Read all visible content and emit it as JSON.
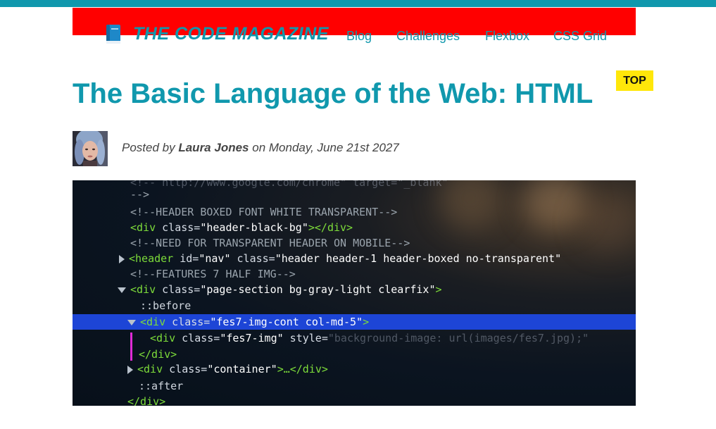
{
  "colors": {
    "accent": "#1098ad",
    "header_bg": "#ff0000",
    "badge_bg": "#ffe70a",
    "highlight": "#1d45d6",
    "code_tag": "#7ddc3a"
  },
  "header": {
    "brand_icon": "book-icon",
    "brand_name": "THE CODE MAGAZINE",
    "nav": [
      "Blog",
      "Challenges",
      "Flexbox",
      "CSS Grid"
    ]
  },
  "top_button": "TOP",
  "article": {
    "title": "The Basic Language of the Web: HTML",
    "byline": {
      "prefix": "Posted by",
      "author": "Laura Jones",
      "middle": "on",
      "date": "Monday, June 21st 2027"
    },
    "avatar_icon": "author-avatar",
    "hero_code": [
      {
        "text": "<!--  http://www.google.com/chrome\" target=\"_blank\"",
        "type": "comment"
      },
      {
        "text": "-->",
        "type": "comment"
      },
      {
        "text": "<!--HEADER BOXED FONT WHITE TRANSPARENT-->",
        "type": "comment"
      },
      {
        "tag": "<div",
        "attr": " class=",
        "val": "\"header-black-bg\"",
        "close": "></div>"
      },
      {
        "text": "<!--NEED FOR TRANSPARENT HEADER ON MOBILE-->",
        "type": "comment"
      },
      {
        "tag": "<header",
        "attr": " id=",
        "val": "\"nav\"",
        "attr2": " class=",
        "val2": "\"header header-1 header-boxed no-transparent\""
      },
      {
        "text": "<!--FEATURES 7 HALF IMG-->",
        "type": "comment"
      },
      {
        "tag": "<div",
        "attr": " class=",
        "val": "\"page-section bg-gray-light clearfix\"",
        "close": ">"
      },
      {
        "text": "::before",
        "type": "pseudo"
      },
      {
        "tag": "<div",
        "attr": " class=",
        "val": "\"fes7-img-cont col-md-5\"",
        "close": ">"
      },
      {
        "tag": "<div",
        "attr": " class=",
        "val": "\"fes7-img\"",
        "attr2": " style=",
        "val2": "\"background-image: url(images/fes7.jpg);\""
      },
      {
        "tag": "</div>",
        "type": "closetag"
      },
      {
        "tag": "<div",
        "attr": " class=",
        "val": "\"container\"",
        "close": ">…</div>"
      },
      {
        "text": "::after",
        "type": "pseudo"
      },
      {
        "tag": "</div>",
        "type": "closetag"
      }
    ]
  }
}
